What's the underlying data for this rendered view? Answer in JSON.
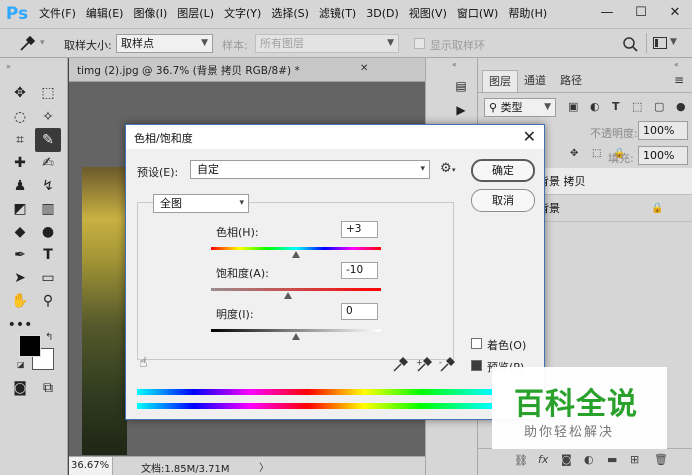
{
  "menubar": {
    "logo": "Ps",
    "items": [
      "文件(F)",
      "编辑(E)",
      "图像(I)",
      "图层(L)",
      "文字(Y)",
      "选择(S)",
      "滤镜(T)",
      "3D(D)",
      "视图(V)",
      "窗口(W)",
      "帮助(H)"
    ],
    "controls": {
      "minimize": "—",
      "maximize": "☐",
      "close": "✕"
    }
  },
  "options": {
    "sample_size_label": "取样大小:",
    "sample_size_value": "取样点",
    "sample_label": "样本:",
    "sample_value": "所有图层",
    "show_ring_label": "显示取样环"
  },
  "document": {
    "tab_label": "timg (2).jpg @ 36.7% (背景 拷贝  RGB/8#) *",
    "close": "✕",
    "zoom": "36.67%",
    "doc_size": "文档:1.85M/3.71M"
  },
  "panels": {
    "tabs": [
      "图层",
      "通道",
      "路径"
    ],
    "filter_label": "类型",
    "opacity_label": "不透明度:",
    "opacity_value": "100%",
    "fill_label": "填充:",
    "fill_value": "100%",
    "layers": [
      "背景 拷贝",
      "背景"
    ]
  },
  "dialog": {
    "title": "色相/饱和度",
    "close": "✕",
    "preset_label": "预设(E):",
    "preset_value": "自定",
    "ok_label": "确定",
    "cancel_label": "取消",
    "channel_value": "全图",
    "hue_label": "色相(H):",
    "hue_value": "+3",
    "saturation_label": "饱和度(A):",
    "saturation_value": "-10",
    "lightness_label": "明度(I):",
    "lightness_value": "0",
    "colorize_label": "着色(O)",
    "preview_label": "预览(P)",
    "colorize_checked": false,
    "preview_checked": true,
    "slider_fraction": {
      "hue": 0.5,
      "saturation": 0.45,
      "lightness": 0.5
    }
  },
  "watermark": {
    "main": "百科全说",
    "sub": "助你轻松解决"
  },
  "colors": {
    "foreground": "#000000",
    "background": "#ffffff",
    "accent": "#3f72b5",
    "watermark_green": "#2aa12a"
  }
}
